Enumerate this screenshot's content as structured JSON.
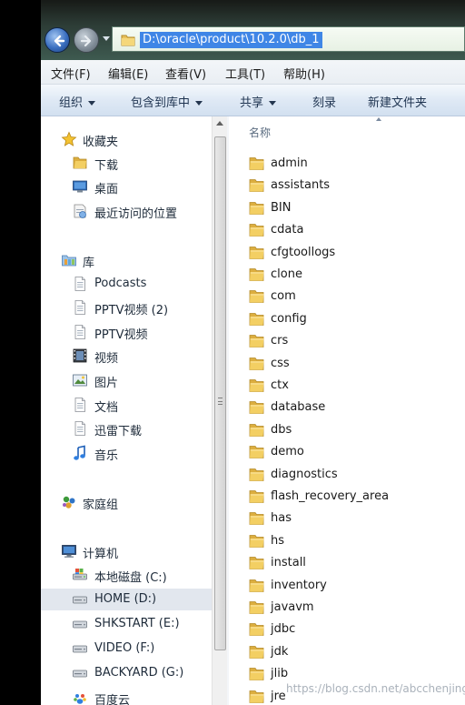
{
  "address": {
    "path": "D:\\oracle\\product\\10.2.0\\db_1"
  },
  "menu": [
    {
      "label": "文件(F)",
      "name": "menu-file"
    },
    {
      "label": "编辑(E)",
      "name": "menu-edit"
    },
    {
      "label": "查看(V)",
      "name": "menu-view"
    },
    {
      "label": "工具(T)",
      "name": "menu-tools"
    },
    {
      "label": "帮助(H)",
      "name": "menu-help"
    }
  ],
  "commands": [
    {
      "label": "组织",
      "dropdown": true,
      "name": "organize-button"
    },
    {
      "label": "包含到库中",
      "dropdown": true,
      "name": "include-in-library-button"
    },
    {
      "label": "共享",
      "dropdown": true,
      "name": "share-button"
    },
    {
      "label": "刻录",
      "dropdown": false,
      "name": "burn-button"
    },
    {
      "label": "新建文件夹",
      "dropdown": false,
      "name": "new-folder-button"
    }
  ],
  "nav": [
    {
      "label": "收藏夹",
      "icon": "star-icon",
      "level": 0,
      "name": "nav-favorites"
    },
    {
      "label": "下载",
      "icon": "folder-icon",
      "level": 1,
      "name": "nav-downloads"
    },
    {
      "label": "桌面",
      "icon": "desktop-icon",
      "level": 1,
      "name": "nav-desktop"
    },
    {
      "label": "最近访问的位置",
      "icon": "recent-places-icon",
      "level": 1,
      "name": "nav-recent-places"
    },
    {
      "label": "库",
      "icon": "library-icon",
      "level": 0,
      "name": "nav-libraries"
    },
    {
      "label": "Podcasts",
      "icon": "document-icon",
      "level": 1,
      "name": "nav-podcasts"
    },
    {
      "label": "PPTV视频 (2)",
      "icon": "document-icon",
      "level": 1,
      "name": "nav-pptv-2"
    },
    {
      "label": "PPTV视频",
      "icon": "document-icon",
      "level": 1,
      "name": "nav-pptv"
    },
    {
      "label": "视频",
      "icon": "video-icon",
      "level": 1,
      "name": "nav-videos"
    },
    {
      "label": "图片",
      "icon": "picture-icon",
      "level": 1,
      "name": "nav-pictures"
    },
    {
      "label": "文档",
      "icon": "document-icon",
      "level": 1,
      "name": "nav-documents"
    },
    {
      "label": "迅雷下载",
      "icon": "document-icon",
      "level": 1,
      "name": "nav-thunder-downloads"
    },
    {
      "label": "音乐",
      "icon": "music-icon",
      "level": 1,
      "name": "nav-music"
    },
    {
      "label": "家庭组",
      "icon": "homegroup-icon",
      "level": 0,
      "name": "nav-homegroup"
    },
    {
      "label": "计算机",
      "icon": "computer-icon",
      "level": 0,
      "name": "nav-computer"
    },
    {
      "label": "本地磁盘 (C:)",
      "icon": "system-drive-icon",
      "level": 1,
      "name": "nav-drive-c"
    },
    {
      "label": "HOME (D:)",
      "icon": "drive-icon",
      "level": 1,
      "selected": true,
      "name": "nav-drive-d"
    },
    {
      "label": "SHKSTART (E:)",
      "icon": "drive-icon",
      "level": 1,
      "name": "nav-drive-e"
    },
    {
      "label": "VIDEO (F:)",
      "icon": "drive-icon",
      "level": 1,
      "name": "nav-drive-f"
    },
    {
      "label": "BACKYARD (G:)",
      "icon": "drive-icon",
      "level": 1,
      "name": "nav-drive-g"
    },
    {
      "label": "百度云",
      "icon": "cloud-icon",
      "level": 1,
      "name": "nav-baidu-cloud"
    }
  ],
  "file_list": {
    "column_header": "名称",
    "items": [
      "admin",
      "assistants",
      "BIN",
      "cdata",
      "cfgtoollogs",
      "clone",
      "com",
      "config",
      "crs",
      "css",
      "ctx",
      "database",
      "dbs",
      "demo",
      "diagnostics",
      "flash_recovery_area",
      "has",
      "hs",
      "install",
      "inventory",
      "javavm",
      "jdbc",
      "jdk",
      "jlib",
      "jre"
    ]
  },
  "watermark": "https://blog.csdn.net/abcchenjing"
}
